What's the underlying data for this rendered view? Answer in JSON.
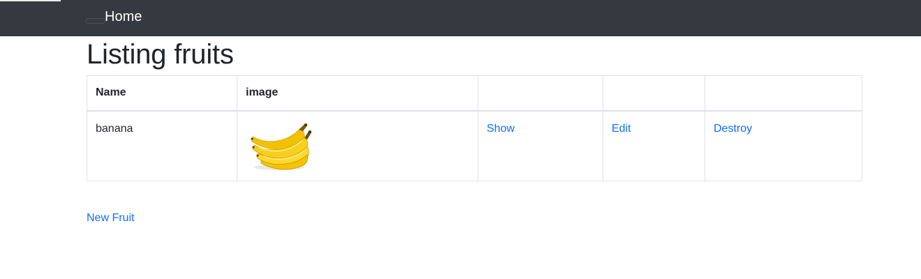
{
  "navbar": {
    "brand_label": "Home"
  },
  "page": {
    "title": "Listing fruits"
  },
  "table": {
    "headers": [
      "Name",
      "image",
      "",
      "",
      ""
    ],
    "rows": [
      {
        "name": "banana",
        "image_alt": "banana",
        "actions": {
          "show": "Show",
          "edit": "Edit",
          "destroy": "Destroy"
        }
      }
    ]
  },
  "footer_link": {
    "new_label": "New Fruit"
  },
  "colors": {
    "navbar_bg": "#343a40",
    "link": "#0d6efd",
    "text": "#212529",
    "border": "#dee2e6"
  }
}
